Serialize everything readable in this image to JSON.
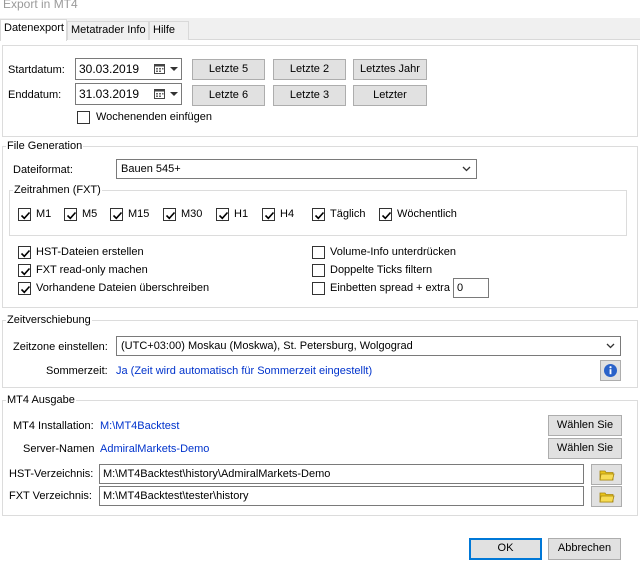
{
  "window": {
    "title": "Export in MT4"
  },
  "tabs": [
    {
      "label": "Datenexport"
    },
    {
      "label": "Metatrader Info"
    },
    {
      "label": "Hilfe"
    }
  ],
  "dates": {
    "start_label": "Startdatum:",
    "start_value": "30.03.2019",
    "end_label": "Enddatum:",
    "end_value": "31.03.2019",
    "weekends_label": "Wochenenden einfügen",
    "weekends_checked": false
  },
  "quick_buttons": {
    "letzte5": "Letzte 5",
    "letzte2": "Letzte 2",
    "letztes_jahr": "Letztes Jahr",
    "letzte6": "Letzte 6",
    "letzte3": "Letzte 3",
    "letzter": "Letzter"
  },
  "file_generation": {
    "title": "File Generation",
    "format_label": "Dateiformat:",
    "format_value": "Bauen 545+",
    "timeframes_title": "Zeitrahmen (FXT)",
    "timeframes": [
      {
        "label": "M1",
        "checked": true
      },
      {
        "label": "M5",
        "checked": true
      },
      {
        "label": "M15",
        "checked": true
      },
      {
        "label": "M30",
        "checked": true
      },
      {
        "label": "H1",
        "checked": true
      },
      {
        "label": "H4",
        "checked": true
      },
      {
        "label": "Täglich",
        "checked": true
      },
      {
        "label": "Wöchentlich",
        "checked": true
      }
    ],
    "left_options": [
      {
        "label": "HST-Dateien erstellen",
        "checked": true
      },
      {
        "label": "FXT read-only machen",
        "checked": true
      },
      {
        "label": "Vorhandene Dateien überschreiben",
        "checked": true
      }
    ],
    "right_options": [
      {
        "label": "Volume-Info unterdrücken",
        "checked": false
      },
      {
        "label": "Doppelte Ticks filtern",
        "checked": false
      },
      {
        "label": "Einbetten spread",
        "checked": false
      }
    ],
    "extra_label": "+ extra",
    "extra_value": "0"
  },
  "timeshift": {
    "title": "Zeitverschiebung",
    "zone_label": "Zeitzone einstellen:",
    "zone_value": "(UTC+03:00) Moskau (Moskwa), St. Petersburg, Wolgograd",
    "dst_label": "Sommerzeit:",
    "dst_value": "Ja (Zeit wird automatisch für Sommerzeit eingestellt)"
  },
  "mt4_output": {
    "title": "MT4 Ausgabe",
    "install_label": "MT4 Installation:",
    "install_value": "M:\\MT4Backtest",
    "server_label": "Server-Namen",
    "server_value": "AdmiralMarkets-Demo",
    "choose_label": "Wählen Sie",
    "hst_label": "HST-Verzeichnis:",
    "hst_value": "M:\\MT4Backtest\\history\\AdmiralMarkets-Demo",
    "fxt_label": "FXT Verzeichnis:",
    "fxt_value": "M:\\MT4Backtest\\tester\\history"
  },
  "footer": {
    "ok_label": "OK",
    "cancel_label": "Abbrechen"
  },
  "colors": {
    "accent": "#0078d7",
    "link_value": "#0033cc",
    "folder_icon": "#e8c31a"
  }
}
